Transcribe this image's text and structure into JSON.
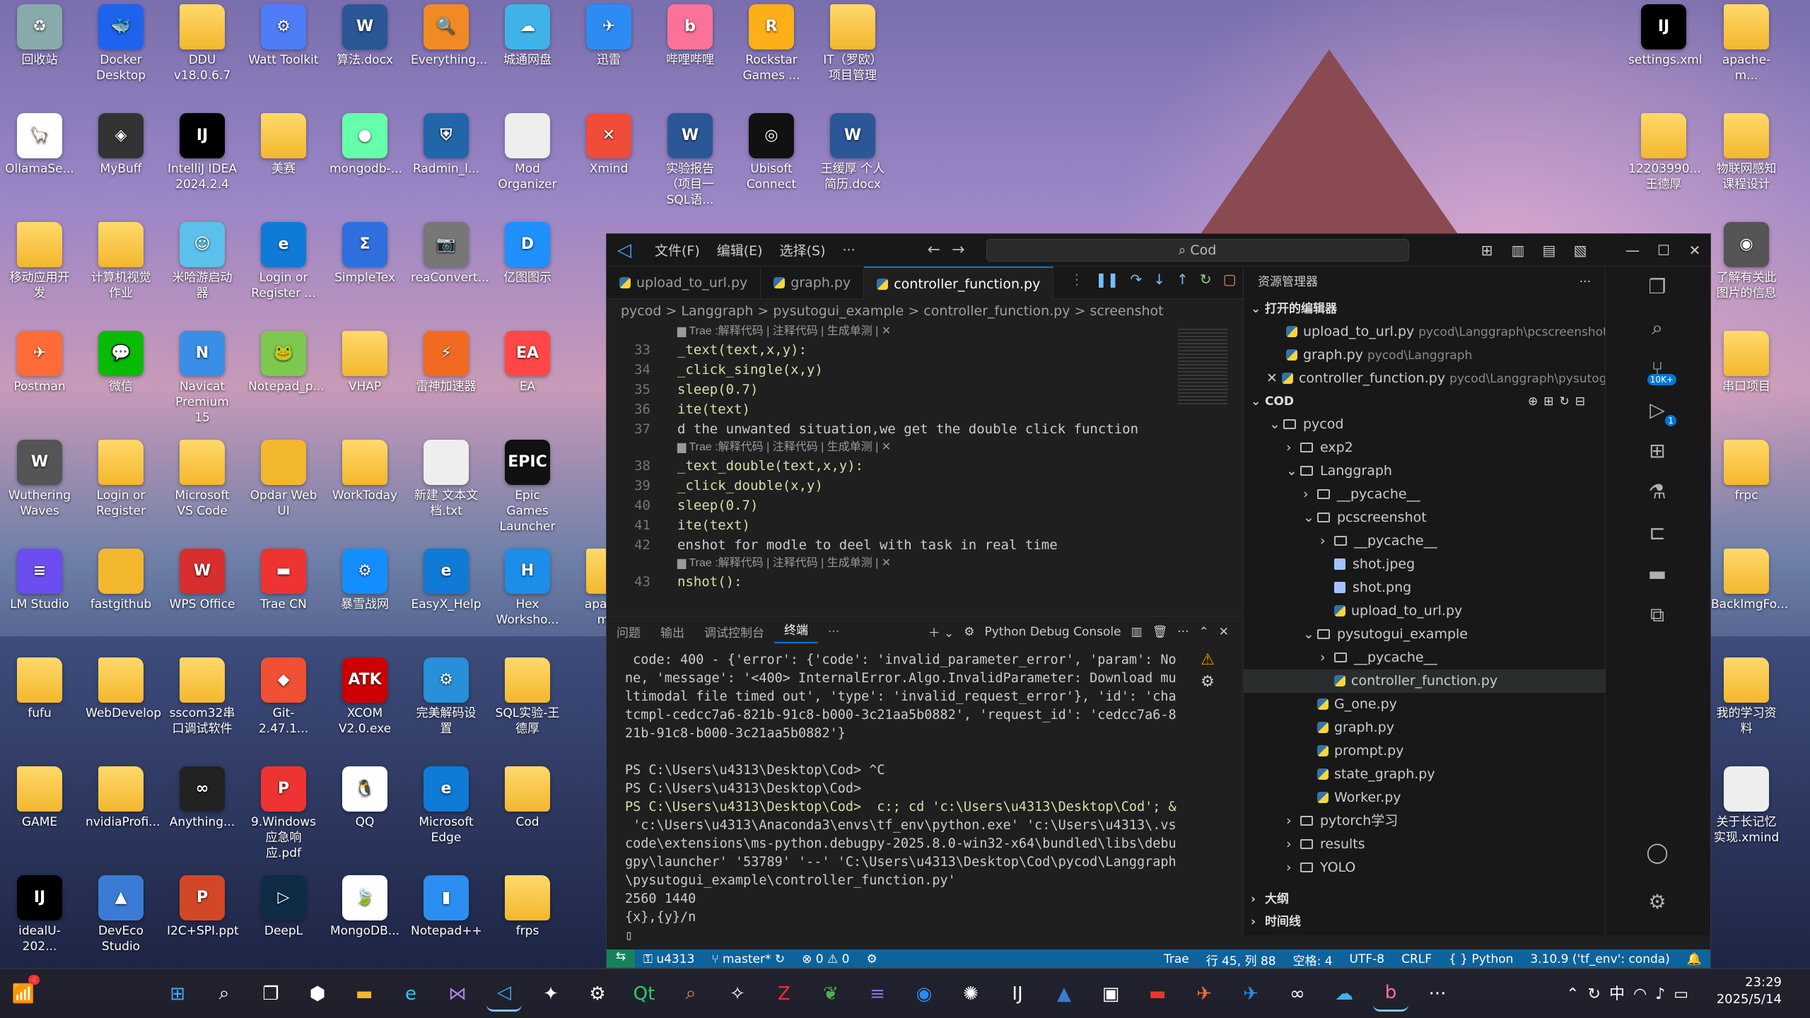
{
  "desktop_icons": [
    {
      "label": "回收站",
      "icon": "recycle-bin-icon",
      "color": "#8aa",
      "glyph": "♻"
    },
    {
      "label": "Docker Desktop",
      "icon": "docker-icon",
      "color": "#1d63ed",
      "glyph": "🐳"
    },
    {
      "label": "DDU v18.0.6.7",
      "icon": "folder-icon",
      "color": "#f3b72e",
      "glyph": ""
    },
    {
      "label": "Watt Toolkit",
      "icon": "watt-toolkit-icon",
      "color": "#4f7cf7",
      "glyph": "⚙"
    },
    {
      "label": "算法.docx",
      "icon": "word-doc-icon",
      "color": "#2b5797",
      "glyph": "W"
    },
    {
      "label": "Everything...",
      "icon": "everything-search-icon",
      "color": "#f08a24",
      "glyph": "🔍"
    },
    {
      "label": "城通网盘",
      "icon": "cloud-drive-icon",
      "color": "#3fb2e8",
      "glyph": "☁"
    },
    {
      "label": "迅雷",
      "icon": "thunder-icon",
      "color": "#2c8cf4",
      "glyph": "✈"
    },
    {
      "label": "哔哩哔哩",
      "icon": "bilibili-icon",
      "color": "#fb7299",
      "glyph": "b"
    },
    {
      "label": "Rockstar Games ...",
      "icon": "rockstar-icon",
      "color": "#fcaf17",
      "glyph": "R"
    },
    {
      "label": "IT（罗欧）项目管理",
      "icon": "folder-icon",
      "color": "#f3b72e",
      "glyph": ""
    },
    {
      "label": "OllamaSe...",
      "icon": "ollama-icon",
      "color": "#ffffff",
      "glyph": "🦙"
    },
    {
      "label": "MyBuff",
      "icon": "mybuff-icon",
      "color": "#333",
      "glyph": "◈"
    },
    {
      "label": "IntelliJ IDEA 2024.2.4",
      "icon": "intellij-icon",
      "color": "#000",
      "glyph": "IJ"
    },
    {
      "label": "美赛",
      "icon": "folder-icon",
      "color": "#f3b72e",
      "glyph": ""
    },
    {
      "label": "mongodb-...",
      "icon": "mongodb-disk-icon",
      "color": "#6fa",
      "glyph": "●"
    },
    {
      "label": "Radmin_l...",
      "icon": "radmin-icon",
      "color": "#26a",
      "glyph": "⛨"
    },
    {
      "label": "Mod Organizer",
      "icon": "file-icon",
      "color": "#eee",
      "glyph": ""
    },
    {
      "label": "Xmind",
      "icon": "xmind-icon",
      "color": "#f04c3a",
      "glyph": "✕"
    },
    {
      "label": "实验报告（项目一SQL语...",
      "icon": "word-doc-icon",
      "color": "#2b5797",
      "glyph": "W"
    },
    {
      "label": "Ubisoft Connect",
      "icon": "ubisoft-icon",
      "color": "#111",
      "glyph": "◎"
    },
    {
      "label": "王缓厚 个人简历.docx",
      "icon": "word-doc-icon",
      "color": "#2b5797",
      "glyph": "W"
    },
    {
      "label": "移动应用开发",
      "icon": "folder-icon",
      "color": "#f3b72e",
      "glyph": ""
    },
    {
      "label": "计算机视觉作业",
      "icon": "folder-icon",
      "color": "#f3b72e",
      "glyph": ""
    },
    {
      "label": "米哈游启动器",
      "icon": "mihoyo-icon",
      "color": "#5bc0eb",
      "glyph": "☺"
    },
    {
      "label": "Login or Register ...",
      "icon": "edge-icon",
      "color": "#0f7bd6",
      "glyph": "e"
    },
    {
      "label": "SimpleTex",
      "icon": "simpletex-icon",
      "color": "#2f6fde",
      "glyph": "Σ"
    },
    {
      "label": "reaConvert...",
      "icon": "reaconvert-icon",
      "color": "#777",
      "glyph": "📷"
    },
    {
      "label": "亿图图示",
      "icon": "edraw-icon",
      "color": "#1e90ff",
      "glyph": "D"
    },
    {
      "label": "Postman",
      "icon": "postman-icon",
      "color": "#ff6c37",
      "glyph": "✈"
    },
    {
      "label": "微信",
      "icon": "wechat-icon",
      "color": "#09bb07",
      "glyph": "💬"
    },
    {
      "label": "Navicat Premium 15",
      "icon": "navicat-icon",
      "color": "#3a8ee6",
      "glyph": "N"
    },
    {
      "label": "Notepad_p...",
      "icon": "notepadpp-icon",
      "color": "#7ec850",
      "glyph": "🐸"
    },
    {
      "label": "VHAP",
      "icon": "folder-icon",
      "color": "#f3b72e",
      "glyph": ""
    },
    {
      "label": "雷神加速器",
      "icon": "leishen-icon",
      "color": "#f26a21",
      "glyph": "⚡"
    },
    {
      "label": "EA",
      "icon": "ea-icon",
      "color": "#ff4747",
      "glyph": "EA"
    },
    {
      "label": "Wuthering Waves",
      "icon": "wuthering-waves-icon",
      "color": "#555",
      "glyph": "W"
    },
    {
      "label": "Login or Register",
      "icon": "folder-icon",
      "color": "#f3b72e",
      "glyph": ""
    },
    {
      "label": "Microsoft VS Code",
      "icon": "folder-icon",
      "color": "#f3b72e",
      "glyph": ""
    },
    {
      "label": "Opdar Web UI",
      "icon": "ollama-webui-icon",
      "color": "#f3b72e",
      "glyph": ""
    },
    {
      "label": "WorkToday",
      "icon": "folder-icon",
      "color": "#f3b72e",
      "glyph": ""
    },
    {
      "label": "新建 文本文档.txt",
      "icon": "text-file-icon",
      "color": "#eee",
      "glyph": ""
    },
    {
      "label": "Epic Games Launcher",
      "icon": "epic-games-icon",
      "color": "#111",
      "glyph": "EPIC"
    },
    {
      "label": "LM Studio",
      "icon": "lm-studio-icon",
      "color": "#6b4df0",
      "glyph": "≡"
    },
    {
      "label": "fastgithub",
      "icon": "fastgithub-icon",
      "color": "#f3b72e",
      "glyph": ""
    },
    {
      "label": "WPS Office",
      "icon": "wps-icon",
      "color": "#d92e2e",
      "glyph": "W"
    },
    {
      "label": "Trae CN",
      "icon": "trae-icon",
      "color": "#e33",
      "glyph": "▬"
    },
    {
      "label": "暴雪战网",
      "icon": "battlenet-icon",
      "color": "#148eff",
      "glyph": "⚙"
    },
    {
      "label": "EasyX_Help",
      "icon": "edge-icon",
      "color": "#0f7bd6",
      "glyph": "e"
    },
    {
      "label": "Hex Worksho...",
      "icon": "hex-workshop-icon",
      "color": "#1c8de8",
      "glyph": "H"
    },
    {
      "label": "apache-m...",
      "icon": "folder-icon",
      "color": "#f3b72e",
      "glyph": ""
    },
    {
      "label": "fufu",
      "icon": "folder-icon",
      "color": "#f3b72e",
      "glyph": ""
    },
    {
      "label": "WebDevelop",
      "icon": "folder-icon",
      "color": "#f3b72e",
      "glyph": ""
    },
    {
      "label": "sscom32串口调试软件",
      "icon": "folder-icon",
      "color": "#f3b72e",
      "glyph": ""
    },
    {
      "label": "Git-2.47.1...",
      "icon": "git-icon",
      "color": "#f05033",
      "glyph": "◆"
    },
    {
      "label": "XCOM V2.0.exe",
      "icon": "xcom-icon",
      "color": "#c00",
      "glyph": "ATK"
    },
    {
      "label": "完美解码设置",
      "icon": "potplayer-settings-icon",
      "color": "#2790d8",
      "glyph": "⚙"
    },
    {
      "label": "SQL实验-王德厚",
      "icon": "folder-icon",
      "color": "#f3b72e",
      "glyph": ""
    },
    {
      "label": "GAME",
      "icon": "folder-icon",
      "color": "#f3b72e",
      "glyph": ""
    },
    {
      "label": "nvidiaProfi...",
      "icon": "folder-icon",
      "color": "#f3b72e",
      "glyph": ""
    },
    {
      "label": "Anything...",
      "icon": "anythingllm-icon",
      "color": "#222",
      "glyph": "∞"
    },
    {
      "label": "9.Windows应急响应.pdf",
      "icon": "pdf-icon",
      "color": "#e33",
      "glyph": "P"
    },
    {
      "label": "QQ",
      "icon": "qq-icon",
      "color": "#fff",
      "glyph": "🐧"
    },
    {
      "label": "Microsoft Edge",
      "icon": "edge-icon",
      "color": "#0f7bd6",
      "glyph": "e"
    },
    {
      "label": "Cod",
      "icon": "folder-icon",
      "color": "#f3b72e",
      "glyph": ""
    },
    {
      "label": "idealU-202...",
      "icon": "intellij-ultimate-icon",
      "color": "#000",
      "glyph": "IJ"
    },
    {
      "label": "DevEco Studio",
      "icon": "deveco-icon",
      "color": "#3a7bd5",
      "glyph": "▲"
    },
    {
      "label": "I2C+SPI.ppt",
      "icon": "ppt-icon",
      "color": "#d24726",
      "glyph": "P"
    },
    {
      "label": "DeepL",
      "icon": "deepl-icon",
      "color": "#0f2b46",
      "glyph": "▷"
    },
    {
      "label": "MongoDB...",
      "icon": "mongodb-icon",
      "color": "#fff",
      "glyph": "🍃"
    },
    {
      "label": "Notepad++",
      "icon": "notepad-icon",
      "color": "#2b8ef0",
      "glyph": "▮"
    },
    {
      "label": "frps",
      "icon": "folder-icon",
      "color": "#f3b72e",
      "glyph": ""
    },
    {
      "label": "settings.xml",
      "icon": "intellij-xml-icon",
      "color": "#000",
      "glyph": "IJ"
    },
    {
      "label": "apache-m...",
      "icon": "folder-icon",
      "color": "#f3b72e",
      "glyph": ""
    },
    {
      "label": "12203990...王德厚",
      "icon": "folder-icon",
      "color": "#f3b72e",
      "glyph": ""
    },
    {
      "label": "物联网感知课程设计",
      "icon": "folder-icon",
      "color": "#f3b72e",
      "glyph": ""
    },
    {
      "label": "了解有关此图片的信息",
      "icon": "spotlight-info-icon",
      "color": "#555",
      "glyph": "◉"
    },
    {
      "label": "串口项目",
      "icon": "folder-icon",
      "color": "#f3b72e",
      "glyph": ""
    },
    {
      "label": "frpc",
      "icon": "folder-icon",
      "color": "#f3b72e",
      "glyph": ""
    },
    {
      "label": "BackImgFo...",
      "icon": "folder-icon",
      "color": "#f3b72e",
      "glyph": ""
    },
    {
      "label": "我的学习资料",
      "icon": "folder-icon",
      "color": "#f3b72e",
      "glyph": ""
    },
    {
      "label": "关于长记忆实现.xmind",
      "icon": "xmind-file-icon",
      "color": "#eee",
      "glyph": ""
    }
  ],
  "vscode": {
    "menu": [
      "文件(F)",
      "编辑(E)",
      "选择(S)",
      "···"
    ],
    "search": "Cod",
    "tabs": [
      {
        "label": "upload_to_url.py"
      },
      {
        "label": "graph.py"
      },
      {
        "label": "controller_function.py"
      }
    ],
    "breadcrumb": "pycod  >  Langgraph  >  pysutogui_example  >  controller_function.py  >  screenshot",
    "codelens": "Trae :解释代码 | 注释代码 | 生成单测 | ✕",
    "code_lines": [
      {
        "type": "lens"
      },
      {
        "n": "33",
        "text": "_text(text,x,y):"
      },
      {
        "n": "34",
        "text": "_click_single(x,y)"
      },
      {
        "n": "35",
        "text": "sleep(0.7)"
      },
      {
        "n": "36",
        "text": "ite(text)"
      },
      {
        "n": "37",
        "text": "d the unwanted situation,we get the double click function"
      },
      {
        "type": "lens"
      },
      {
        "n": "38",
        "text": "_text_double(text,x,y):"
      },
      {
        "n": "39",
        "text": "_click_double(x,y)"
      },
      {
        "n": "40",
        "text": "sleep(0.7)"
      },
      {
        "n": "41",
        "text": "ite(text)"
      },
      {
        "n": "42",
        "text": "enshot for modle to deel with task in real time"
      },
      {
        "type": "lens"
      },
      {
        "n": "43",
        "text": "nshot():"
      }
    ],
    "panel_tabs": [
      "问题",
      "输出",
      "调试控制台",
      "终端",
      "···"
    ],
    "debug_console_label": "Python Debug Console",
    "terminal_lines": [
      " code: 400 - {'error': {'code': 'invalid_parameter_error', 'param': No",
      "ne, 'message': '<400> InternalError.Algo.InvalidParameter: Download mu",
      "ltimodal file timed out', 'type': 'invalid_request_error'}, 'id': 'cha",
      "tcmpl-cedcc7a6-821b-91c8-b000-3c21aa5b0882', 'request_id': 'cedcc7a6-8",
      "21b-91c8-b000-3c21aa5b0882'}",
      "",
      "PS C:\\Users\\u4313\\Desktop\\Cod> ^C",
      "PS C:\\Users\\u4313\\Desktop\\Cod>",
      "PS C:\\Users\\u4313\\Desktop\\Cod>  c:; cd 'c:\\Users\\u4313\\Desktop\\Cod'; &",
      " 'c:\\Users\\u4313\\Anaconda3\\envs\\tf_env\\python.exe' 'c:\\Users\\u4313\\.vs",
      "code\\extensions\\ms-python.debugpy-2025.8.0-win32-x64\\bundled\\libs\\debu",
      "gpy\\launcher' '53789' '--' 'C:\\Users\\u4313\\Desktop\\Cod\\pycod\\Langgraph",
      "\\pysutogui_example\\controller_function.py'",
      "2560 1440",
      "{x},{y}/n",
      "▯"
    ],
    "explorer": {
      "title": "资源管理器",
      "open_editors_label": "打开的编辑器",
      "open_editors": [
        {
          "name": "upload_to_url.py",
          "path": "pycod\\Langgraph\\pcscreenshot"
        },
        {
          "name": "graph.py",
          "path": "pycod\\Langgraph"
        },
        {
          "name": "controller_function.py",
          "path": "pycod\\Langgraph\\pysutogui_example"
        }
      ],
      "root_label": "COD",
      "tree": [
        {
          "depth": 1,
          "kind": "folder",
          "open": true,
          "name": "pycod"
        },
        {
          "depth": 2,
          "kind": "folder",
          "open": false,
          "name": "exp2"
        },
        {
          "depth": 2,
          "kind": "folder",
          "open": true,
          "name": "Langgraph"
        },
        {
          "depth": 3,
          "kind": "folder",
          "open": false,
          "name": "__pycache__"
        },
        {
          "depth": 3,
          "kind": "folder",
          "open": true,
          "name": "pcscreenshot"
        },
        {
          "depth": 4,
          "kind": "folder",
          "open": false,
          "name": "__pycache__"
        },
        {
          "depth": 4,
          "kind": "image",
          "name": "shot.jpeg"
        },
        {
          "depth": 4,
          "kind": "image",
          "name": "shot.png"
        },
        {
          "depth": 4,
          "kind": "py",
          "name": "upload_to_url.py"
        },
        {
          "depth": 3,
          "kind": "folder",
          "open": true,
          "name": "pysutogui_example"
        },
        {
          "depth": 4,
          "kind": "folder",
          "open": false,
          "name": "__pycache__"
        },
        {
          "depth": 4,
          "kind": "py",
          "name": "controller_function.py",
          "selected": true
        },
        {
          "depth": 3,
          "kind": "py",
          "name": "G_one.py"
        },
        {
          "depth": 3,
          "kind": "py",
          "name": "graph.py"
        },
        {
          "depth": 3,
          "kind": "py",
          "name": "prompt.py"
        },
        {
          "depth": 3,
          "kind": "py",
          "name": "state_graph.py"
        },
        {
          "depth": 3,
          "kind": "py",
          "name": "Worker.py"
        },
        {
          "depth": 2,
          "kind": "folder",
          "open": false,
          "name": "pytorch学习"
        },
        {
          "depth": 2,
          "kind": "folder",
          "open": false,
          "name": "results"
        },
        {
          "depth": 2,
          "kind": "folder",
          "open": false,
          "name": "YOLO"
        }
      ],
      "outline_label": "大纲",
      "timeline_label": "时间线"
    },
    "activity_badges": {
      "source_control": "10K+",
      "run": "1"
    },
    "status": {
      "user": "u4313",
      "branch": "master*",
      "problems": "⊗ 0 ⚠ 0",
      "trae": "Trae",
      "position": "行 45, 列 88",
      "spaces": "空格: 4",
      "encoding": "UTF-8",
      "eol": "CRLF",
      "lang": "{ } Python",
      "interpreter": "3.10.9 ('tf_env': conda)"
    }
  },
  "taskbar": {
    "time": "23:29",
    "date": "2025/5/14",
    "ime": "中",
    "notif_badge": "4"
  }
}
